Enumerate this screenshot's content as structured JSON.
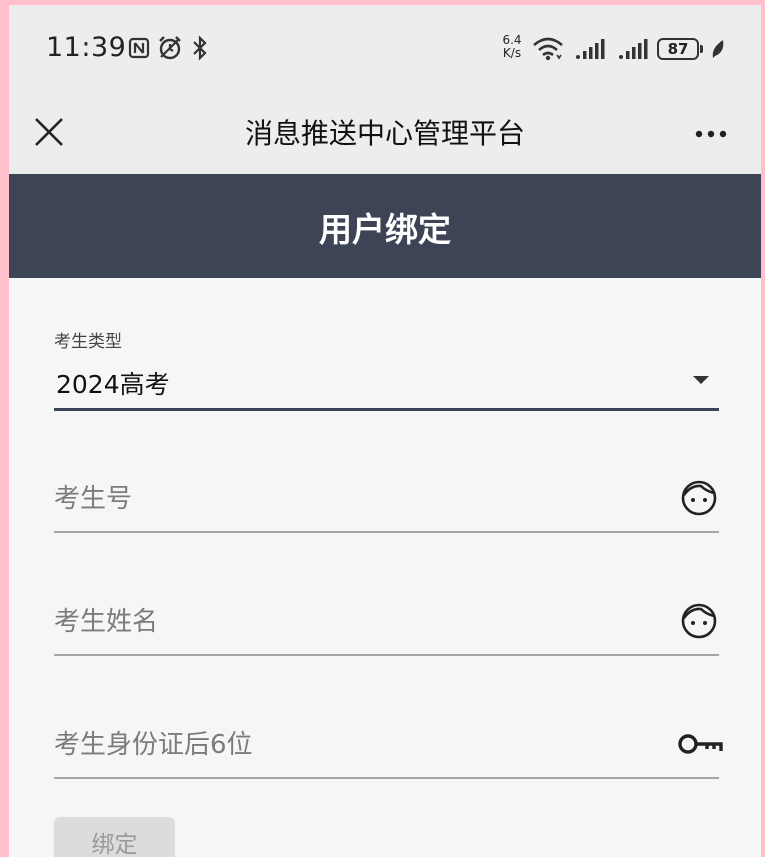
{
  "status_bar": {
    "time": "11:39",
    "net_speed_value": "6.4",
    "net_speed_unit": "K/s",
    "battery": "87",
    "icons": [
      "nfc-icon",
      "alarm-icon",
      "bluetooth-icon",
      "wifi-icon",
      "signal-icon",
      "signal-icon",
      "battery-icon",
      "leaf-icon"
    ]
  },
  "nav": {
    "title": "消息推送中心管理平台",
    "close_icon": "close-icon",
    "more_icon": "more-icon"
  },
  "header": {
    "title": "用户绑定"
  },
  "form": {
    "candidate_type": {
      "label": "考生类型",
      "value": "2024高考"
    },
    "candidate_number": {
      "placeholder": "考生号",
      "icon": "face-icon"
    },
    "candidate_name": {
      "placeholder": "考生姓名",
      "icon": "face-icon"
    },
    "id_suffix": {
      "placeholder": "考生身份证后6位",
      "icon": "key-icon"
    },
    "bind_button": "绑定"
  },
  "colors": {
    "header_bg": "#3d4455",
    "page_bg": "#f6f6f6",
    "frame_bg": "#ffc0cb",
    "topbar_bg": "#ededed"
  }
}
